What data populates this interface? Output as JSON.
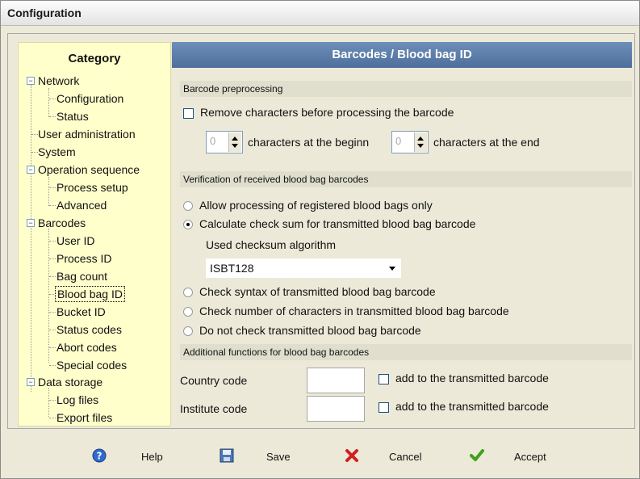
{
  "window": {
    "title": "Configuration"
  },
  "sidebar": {
    "title": "Category",
    "items": [
      {
        "label": "Network",
        "level": 0,
        "expander": "−"
      },
      {
        "label": "Configuration",
        "level": 1
      },
      {
        "label": "Status",
        "level": 1
      },
      {
        "label": "User administration",
        "level": 0
      },
      {
        "label": "System",
        "level": 0
      },
      {
        "label": "Operation sequence",
        "level": 0,
        "expander": "−"
      },
      {
        "label": "Process setup",
        "level": 1
      },
      {
        "label": "Advanced",
        "level": 1
      },
      {
        "label": "Barcodes",
        "level": 0,
        "expander": "−"
      },
      {
        "label": "User ID",
        "level": 1
      },
      {
        "label": "Process ID",
        "level": 1
      },
      {
        "label": "Bag count",
        "level": 1
      },
      {
        "label": "Blood bag ID",
        "level": 1,
        "selected": true
      },
      {
        "label": "Bucket ID",
        "level": 1
      },
      {
        "label": "Status codes",
        "level": 1
      },
      {
        "label": "Abort codes",
        "level": 1
      },
      {
        "label": "Special codes",
        "level": 1
      },
      {
        "label": "Data storage",
        "level": 0,
        "expander": "−"
      },
      {
        "label": "Log files",
        "level": 1
      },
      {
        "label": "Export files",
        "level": 1
      }
    ]
  },
  "main": {
    "header": "Barcodes / Blood bag ID",
    "preprocessing": {
      "section": "Barcode preprocessing",
      "remove_label": "Remove characters before processing the barcode",
      "begin_value": "0",
      "begin_label": "characters at the beginn",
      "end_value": "0",
      "end_label": "characters at the end"
    },
    "verification": {
      "section": "Verification of received blood bag barcodes",
      "opt_registered": "Allow processing of registered blood bags only",
      "opt_checksum": "Calculate check sum for transmitted blood bag barcode",
      "algo_label": "Used checksum algorithm",
      "algo_value": "ISBT128",
      "opt_syntax": "Check syntax of transmitted blood bag barcode",
      "opt_count": "Check number of characters in transmitted blood bag barcode",
      "opt_none": "Do not check transmitted blood bag barcode"
    },
    "additional": {
      "section": "Additional functions for blood bag barcodes",
      "country_label": "Country code",
      "country_value": "",
      "country_add": "add to the transmitted barcode",
      "institute_label": "Institute code",
      "institute_value": "",
      "institute_add": "add to the transmitted barcode"
    }
  },
  "footer": {
    "help": "Help",
    "save": "Save",
    "cancel": "Cancel",
    "accept": "Accept"
  },
  "colors": {
    "header_bg": "#5b7caa",
    "sidebar_bg": "#ffffcc",
    "window_bg": "#ece9d8"
  },
  "icons": {
    "help": "help-icon",
    "save": "floppy-disk-icon",
    "cancel": "red-x-icon",
    "accept": "green-check-icon"
  }
}
